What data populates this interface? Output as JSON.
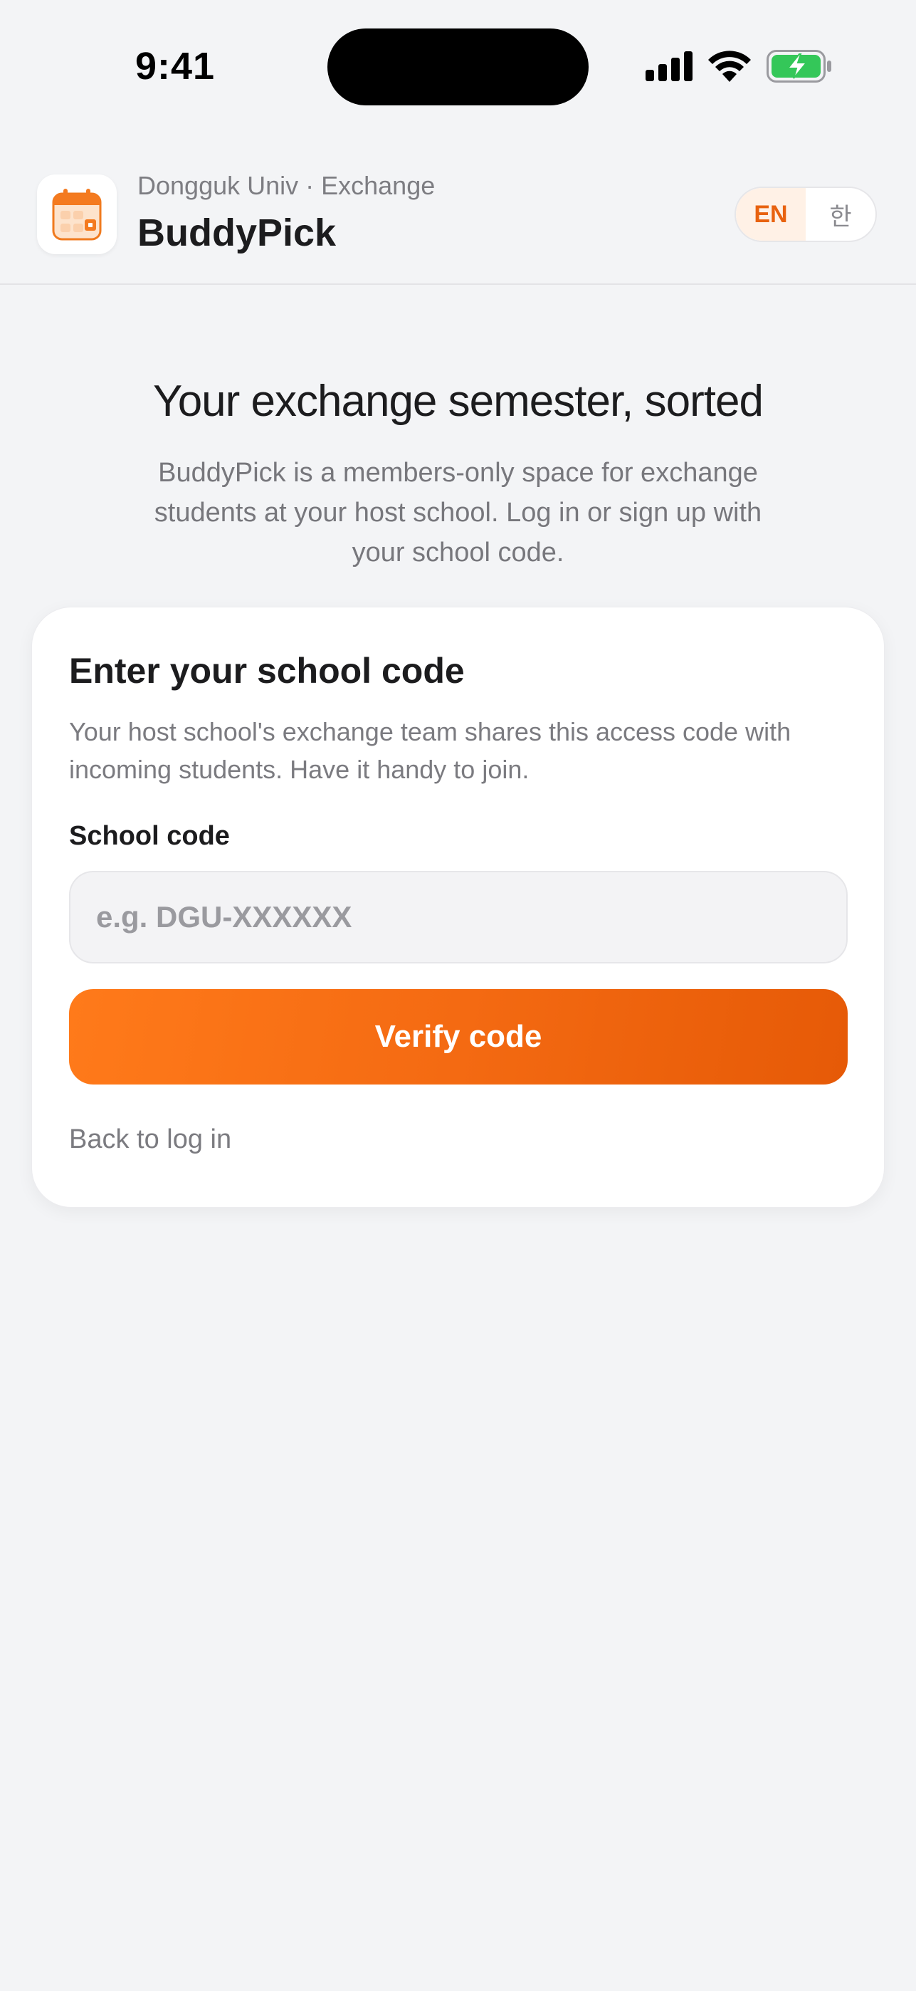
{
  "status_bar": {
    "time": "9:41",
    "icons": [
      "signal-icon",
      "wifi-icon",
      "battery-charging-icon"
    ]
  },
  "header": {
    "subtitle": "Dongguk Univ · Exchange",
    "title": "BuddyPick",
    "app_icon": "calendar-icon",
    "language": {
      "options": [
        "EN",
        "한"
      ],
      "selected": "EN"
    }
  },
  "hero": {
    "title": "Your exchange semester, sorted",
    "description": "BuddyPick is a members-only space for exchange students at your host school. Log in or sign up with your school code."
  },
  "card": {
    "title": "Enter your school code",
    "description": "Your host school's exchange team shares this access code with incoming students. Have it handy to join.",
    "field_label": "School code",
    "input_value": "",
    "input_placeholder": "e.g. DGU-XXXXXX",
    "verify_button": "Verify code",
    "back_link": "Back to log in"
  },
  "colors": {
    "accent": "#f46a12",
    "accent_light": "#fff1e6",
    "background": "#f3f4f6",
    "battery_green": "#34c759"
  }
}
